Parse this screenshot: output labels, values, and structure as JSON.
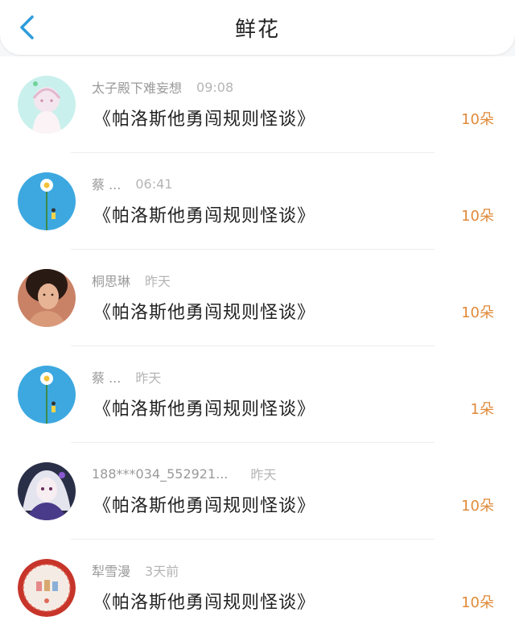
{
  "header": {
    "title": "鲜花",
    "back_icon": "chevron-left-icon",
    "accent_color": "#2d9cdb"
  },
  "items": [
    {
      "name": "太子殿下难妄想",
      "time": "09:08",
      "book": "《帕洛斯他勇闯规则怪谈》",
      "count": "10朵",
      "avatar": "pastel-girl"
    },
    {
      "name": "蔡 ...",
      "time": "06:41",
      "book": "《帕洛斯他勇闯规则怪谈》",
      "count": "10朵",
      "avatar": "flower-blue"
    },
    {
      "name": "桐思琳",
      "time": "昨天",
      "book": "《帕洛斯他勇闯规则怪谈》",
      "count": "10朵",
      "avatar": "portrait"
    },
    {
      "name": "蔡 ...",
      "time": "昨天",
      "book": "《帕洛斯他勇闯规则怪谈》",
      "count": "1朵",
      "avatar": "flower-blue"
    },
    {
      "name": "188***034_552921...",
      "time": "昨天",
      "book": "《帕洛斯他勇闯规则怪谈》",
      "count": "10朵",
      "avatar": "anime-girl"
    },
    {
      "name": "犁雪漫",
      "time": "3天前",
      "book": "《帕洛斯他勇闯规则怪谈》",
      "count": "10朵",
      "avatar": "plate"
    }
  ]
}
